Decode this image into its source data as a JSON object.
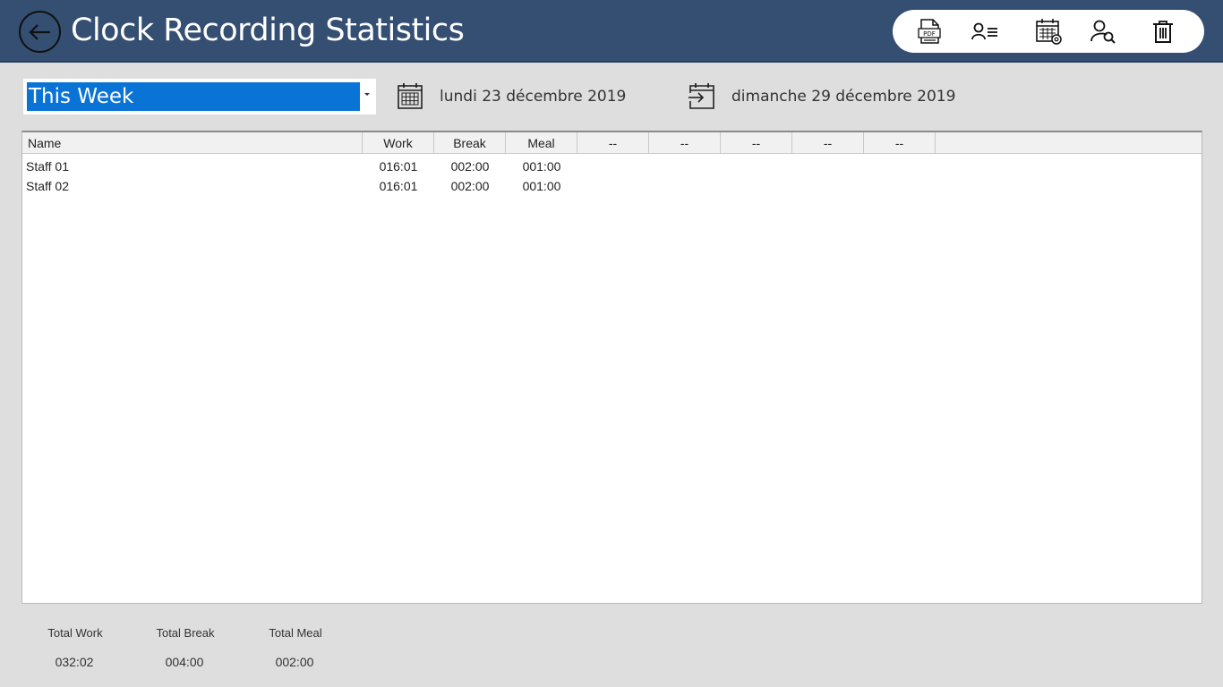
{
  "header": {
    "title": "Clock Recording Statistics",
    "back_icon": "arrow-left-icon",
    "bg_color": "#354f73",
    "toolbar": [
      {
        "id": "pdf",
        "icon": "pdf-icon",
        "label": "PDF"
      },
      {
        "id": "staff-list",
        "icon": "staff-list-icon"
      },
      {
        "id": "calendar-settings",
        "icon": "calendar-settings-icon"
      },
      {
        "id": "search-staff",
        "icon": "person-search-icon"
      },
      {
        "id": "delete",
        "icon": "trash-icon"
      }
    ]
  },
  "filter": {
    "period": "This Week",
    "accent_color": "#0a74d6",
    "start_date": "lundi 23 décembre 2019",
    "end_date": "dimanche 29 décembre 2019"
  },
  "table": {
    "columns": [
      "Name",
      "Work",
      "Break",
      "Meal",
      "--",
      "--",
      "--",
      "--",
      "--"
    ],
    "rows": [
      {
        "name": "Staff 01",
        "work": "016:01",
        "break": "002:00",
        "meal": "001:00"
      },
      {
        "name": "Staff 02",
        "work": "016:01",
        "break": "002:00",
        "meal": "001:00"
      }
    ]
  },
  "totals": {
    "work_label": "Total Work",
    "work_value": "032:02",
    "break_label": "Total Break",
    "break_value": "004:00",
    "meal_label": "Total Meal",
    "meal_value": "002:00"
  }
}
